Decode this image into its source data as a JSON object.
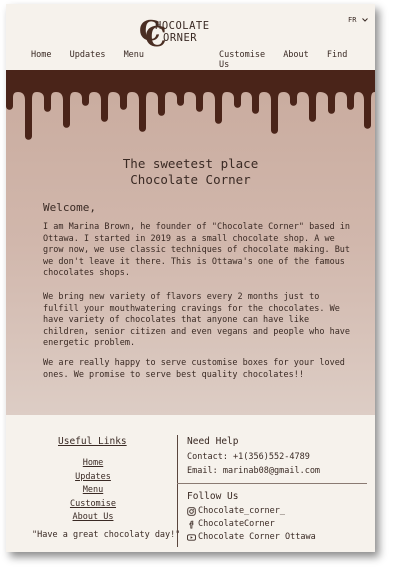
{
  "header": {
    "logo": {
      "line1": "HOCOLATE",
      "line2": "ORNER",
      "initial1": "C",
      "initial2": "C"
    },
    "language": "FR",
    "nav_left": [
      "Home",
      "Updates",
      "Menu"
    ],
    "nav_right": [
      "Customise",
      "About",
      "Find Us"
    ]
  },
  "hero": {
    "title_line1": "The sweetest place",
    "title_line2": "Chocolate Corner",
    "welcome": "Welcome,",
    "para1": "I am Marina Brown, he founder of \"Chocolate Corner\" based in Ottawa. I started in 2019 as a small chocolate shop. A we grow now, we use classic techniques of chocolate making. But we don't leave it there. This is Ottawa's one of the famous chocolates shops.",
    "para2": "We bring new variety of flavors every 2 months just to fulfill your mouthwatering cravings for the chocolates. We have variety of chocolates that anyone can have like children, senior citizen and even vegans and people who have energetic problem.",
    "para3": "We are really happy to serve customise boxes for your loved ones. We promise to serve best quality chocolates!!"
  },
  "footer": {
    "links_title": "Useful Links",
    "links": [
      "Home",
      "Updates",
      "Menu",
      "Customise",
      "About Us"
    ],
    "quote": "\"Have a great chocolaty day!\"",
    "help_title": "Need Help",
    "contact": "Contact: +1(356)552-4789",
    "email": "Email: marinab08@gmail.com",
    "follow_title": "Follow Us",
    "social": [
      {
        "icon": "instagram-icon",
        "label": "Chocolate_corner_"
      },
      {
        "icon": "facebook-icon",
        "label": "ChocolateCorner"
      },
      {
        "icon": "youtube-icon",
        "label": "Chocolate Corner Ottawa"
      }
    ]
  },
  "colors": {
    "page_bg": "#f6f2ec",
    "chocolate": "#4a2419",
    "text": "#3a2a24",
    "hero_bg": "#d1b7ac"
  }
}
